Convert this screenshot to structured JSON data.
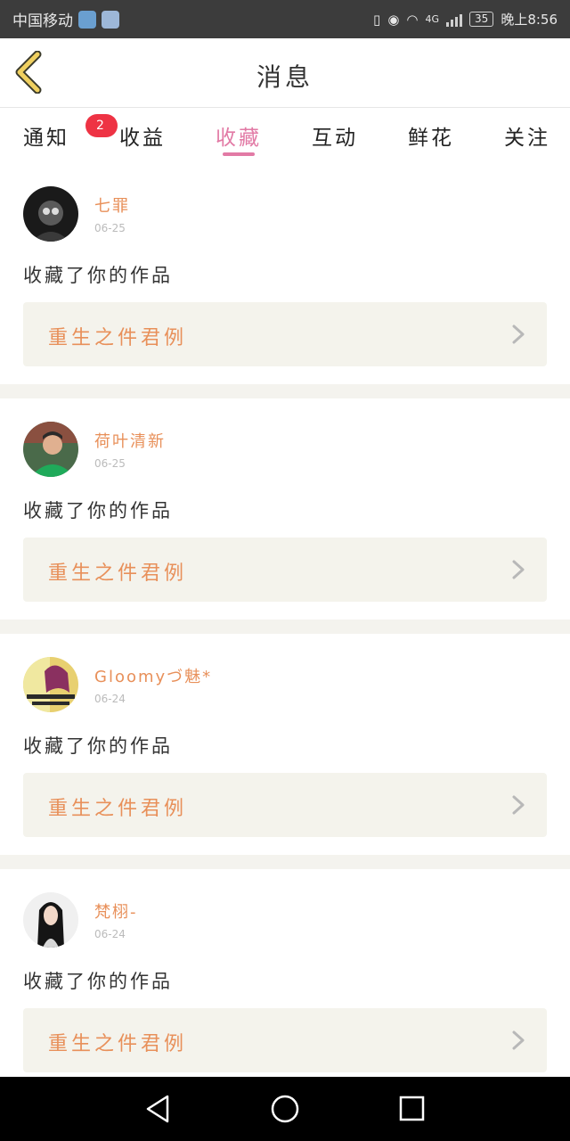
{
  "status_bar": {
    "carrier": "中国移动",
    "network": "4G",
    "battery": "35",
    "time": "晚上8:56"
  },
  "header": {
    "title": "消息",
    "back_icon": "chevron-left-icon"
  },
  "tabs": [
    {
      "label": "通知",
      "badge": "2"
    },
    {
      "label": "收益"
    },
    {
      "label": "收藏",
      "active": true
    },
    {
      "label": "互动"
    },
    {
      "label": "鲜花"
    },
    {
      "label": "关注"
    }
  ],
  "messages": [
    {
      "user": "七罪",
      "date": "06-25",
      "action": "收藏了你的作品",
      "work": "重生之件君例"
    },
    {
      "user": "荷叶清新",
      "date": "06-25",
      "action": "收藏了你的作品",
      "work": "重生之件君例"
    },
    {
      "user": "Gloomyづ魅*",
      "date": "06-24",
      "action": "收藏了你的作品",
      "work": "重生之件君例"
    },
    {
      "user": "梵栩-",
      "date": "06-24",
      "action": "收藏了你的作品",
      "work": "重生之件君例"
    }
  ],
  "colors": {
    "accent": "#e27aa5",
    "name": "#e8905a",
    "badge": "#ee3344",
    "card_bg": "#f4f3ec"
  }
}
